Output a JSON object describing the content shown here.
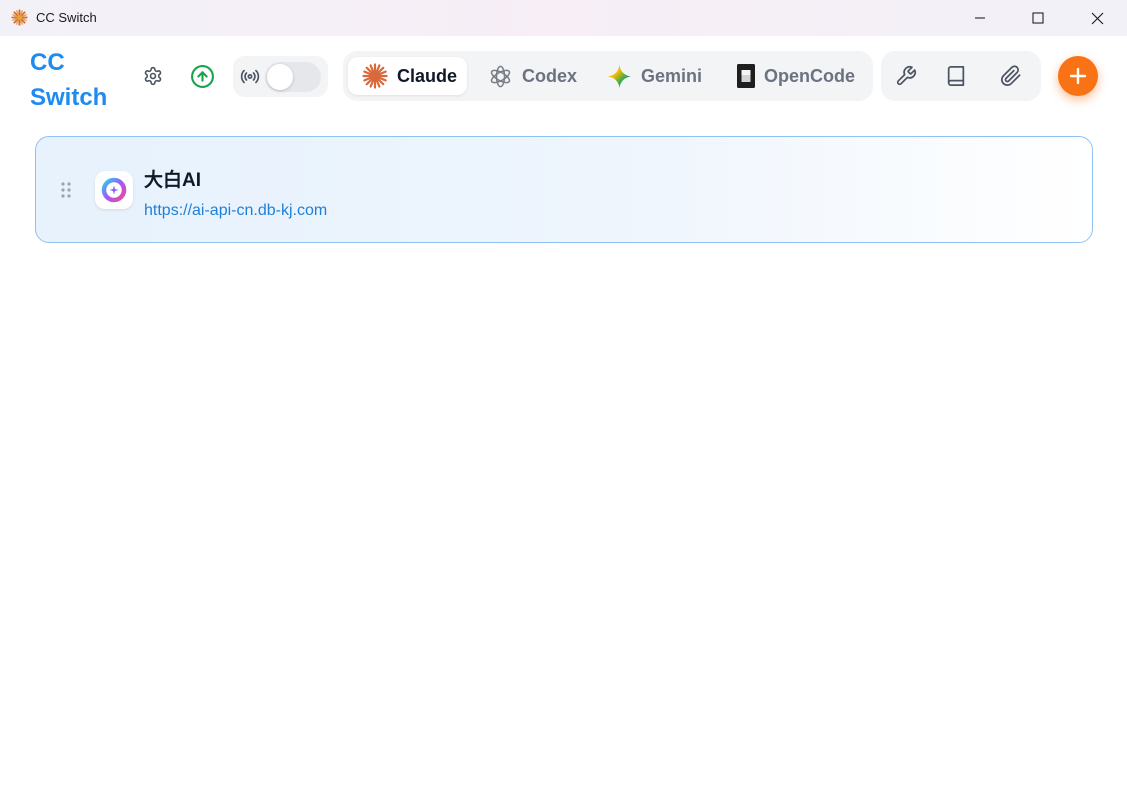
{
  "window": {
    "title": "CC Switch",
    "app_icon": "sunburst-icon"
  },
  "header": {
    "brand": "CC\nSwitch",
    "settings_icon": "gear-icon",
    "upgrade_icon": "arrow-up-circle-icon",
    "proxy_icon": "radio-broadcast-icon",
    "proxy_enabled": false,
    "accent_color": "#1d8bf0"
  },
  "tabs": [
    {
      "label": "Claude",
      "icon": "claude-sunburst-icon",
      "active": true
    },
    {
      "label": "Codex",
      "icon": "openai-knot-icon",
      "active": false
    },
    {
      "label": "Gemini",
      "icon": "gemini-sparkle-icon",
      "active": false
    },
    {
      "label": "OpenCode",
      "icon": "opencode-icon",
      "active": false
    }
  ],
  "tools": [
    "wrench-icon",
    "book-icon",
    "paperclip-icon"
  ],
  "add_button": {
    "icon": "plus-icon",
    "color": "#f97316"
  },
  "providers": [
    {
      "name": "大白AI",
      "url": "https://ai-api-cn.db-kj.com",
      "icon": "dabai-ring-icon"
    }
  ]
}
